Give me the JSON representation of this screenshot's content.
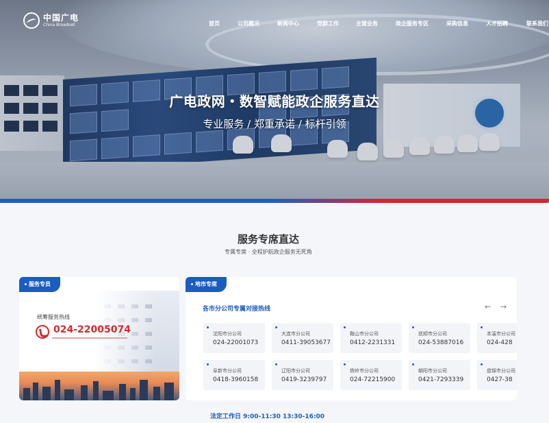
{
  "logo": {
    "cn": "中国广电",
    "en": "China Broadnet"
  },
  "nav": [
    "首页",
    "公司概况",
    "新闻中心",
    "党群工作",
    "主营业务",
    "政企服务专区",
    "采购信息",
    "人才招聘",
    "联系我们"
  ],
  "hero": {
    "title": "广电政网・数智赋能政企服务直达",
    "subtitle": "专业服务 / 郑重承诺 / 标杆引领"
  },
  "section": {
    "title": "服务专席直达",
    "subtitle": "专属专席 · 全程护航政企服务无死角"
  },
  "left_card": {
    "tag": "服务专员",
    "hotline_label": "统筹服务热线",
    "hotline_number": "024-22005074"
  },
  "right_card": {
    "tag": "地市专席",
    "heading": "各市分公司专属对接热线",
    "prev_icon": "arrow-left-icon",
    "next_icon": "arrow-right-icon",
    "cities": [
      {
        "name": "沈阳市分公司",
        "phone": "024-22001073"
      },
      {
        "name": "大连市分公司",
        "phone": "0411-39053677"
      },
      {
        "name": "鞍山市分公司",
        "phone": "0412-2231331"
      },
      {
        "name": "抚顺市分公司",
        "phone": "024-53887016"
      },
      {
        "name": "本溪市分公司",
        "phone": "024-428"
      },
      {
        "name": "阜新市分公司",
        "phone": "0418-3960158"
      },
      {
        "name": "辽阳市分公司",
        "phone": "0419-3239797"
      },
      {
        "name": "铁岭市分公司",
        "phone": "024-72215900"
      },
      {
        "name": "朝阳市分公司",
        "phone": "0421-7293339"
      },
      {
        "name": "盘锦市分公司",
        "phone": "0427-38"
      }
    ]
  },
  "hours": "法定工作日 9:00-11:30 13:30-16:00",
  "colors": {
    "accent_blue": "#1a5cc0",
    "hotline_red": "#d42a2a"
  }
}
